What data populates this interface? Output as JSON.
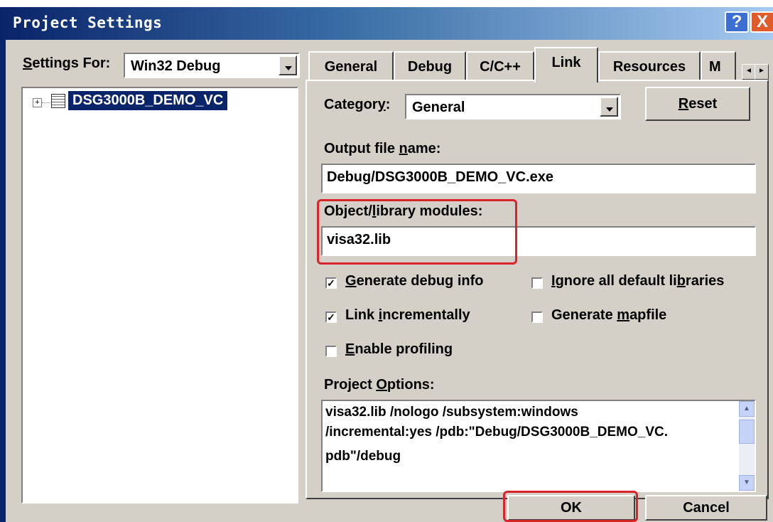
{
  "window": {
    "title": "Project Settings",
    "help_label": "?",
    "close_label": "X"
  },
  "left": {
    "settings_for_label": "Settings For:",
    "settings_for_value": "Win32 Debug",
    "tree": {
      "expand_glyph": "+",
      "project_name": "DSG3000B_DEMO_VC"
    }
  },
  "tabs": [
    {
      "label": "General",
      "active": false
    },
    {
      "label": "Debug",
      "active": false
    },
    {
      "label": "C/C++",
      "active": false
    },
    {
      "label": "Link",
      "active": true
    },
    {
      "label": "Resources",
      "active": false
    },
    {
      "label": "M",
      "active": false
    }
  ],
  "tab_scroll": {
    "left_glyph": "◄",
    "right_glyph": "►"
  },
  "link": {
    "category_label": "Category:",
    "category_value": "General",
    "reset_label": "Reset",
    "output_label": "Output file name:",
    "output_value": "Debug/DSG3000B_DEMO_VC.exe",
    "objlib_label": "Object/library modules:",
    "objlib_value": "visa32.lib",
    "options": {
      "generate_debug_info": {
        "label": "Generate debug info",
        "checked": true
      },
      "ignore_default_libs": {
        "label": "Ignore all default libraries",
        "checked": false
      },
      "link_incrementally": {
        "label": "Link incrementally",
        "checked": true
      },
      "generate_mapfile": {
        "label": "Generate mapfile",
        "checked": false
      },
      "enable_profiling": {
        "label": "Enable profiling",
        "checked": false
      }
    },
    "project_options_label": "Project Options:",
    "project_options_lines": [
      "visa32.lib /nologo /subsystem:windows",
      "/incremental:yes /pdb:\"Debug/DSG3000B_DEMO_VC.",
      "pdb\"/debug"
    ]
  },
  "footer": {
    "ok_label": "OK",
    "cancel_label": "Cancel"
  },
  "colors": {
    "annotation": "#d9242b",
    "titlebar": "#0a246a",
    "selection": "#0a246a"
  }
}
